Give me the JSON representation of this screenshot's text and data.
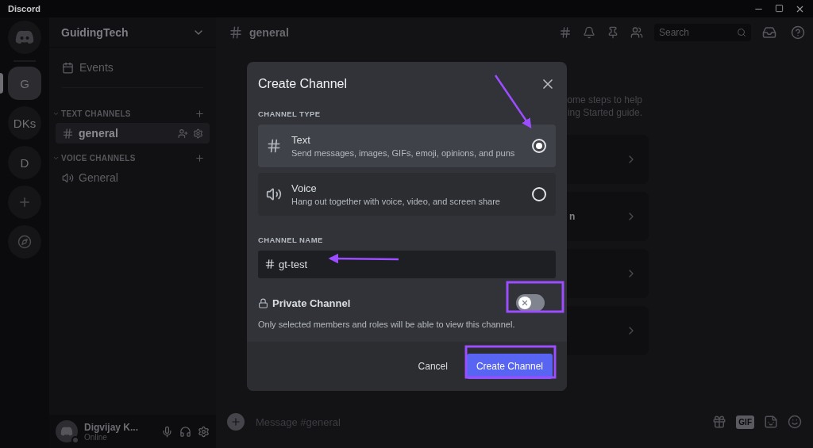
{
  "window": {
    "title": "Discord"
  },
  "servers": [
    {
      "label": "G",
      "selected": true
    },
    {
      "label": "DKs",
      "selected": false
    },
    {
      "label": "D",
      "selected": false
    }
  ],
  "sidebar": {
    "server_name": "GuidingTech",
    "events": "Events",
    "categories": [
      {
        "name": "TEXT CHANNELS",
        "channels": [
          {
            "name": "general",
            "kind": "text",
            "selected": true
          }
        ]
      },
      {
        "name": "VOICE CHANNELS",
        "channels": [
          {
            "name": "General",
            "kind": "voice",
            "selected": false
          }
        ]
      }
    ]
  },
  "user": {
    "name": "Digvijay K...",
    "status": "Online"
  },
  "header": {
    "channel": "general",
    "search_placeholder": "Search"
  },
  "welcome": {
    "lines": [
      "ome steps to help",
      "ing Started guide."
    ],
    "cards": [
      {
        "kind": "blank"
      },
      {
        "kind": "labeled",
        "label": "n"
      },
      {
        "kind": "blank"
      },
      {
        "kind": "blank"
      }
    ]
  },
  "composer": {
    "placeholder": "Message #general",
    "gif_label": "GIF"
  },
  "modal": {
    "title": "Create Channel",
    "type_label": "CHANNEL TYPE",
    "types": [
      {
        "kind": "text",
        "name": "Text",
        "description": "Send messages, images, GIFs, emoji, opinions, and puns",
        "selected": true
      },
      {
        "kind": "voice",
        "name": "Voice",
        "description": "Hang out together with voice, video, and screen share",
        "selected": false
      }
    ],
    "name_label": "CHANNEL NAME",
    "name_value": "gt-test",
    "private": {
      "label": "Private Channel",
      "on": false,
      "description": "Only selected members and roles will be able to view this channel."
    },
    "cancel": "Cancel",
    "submit": "Create Channel"
  }
}
